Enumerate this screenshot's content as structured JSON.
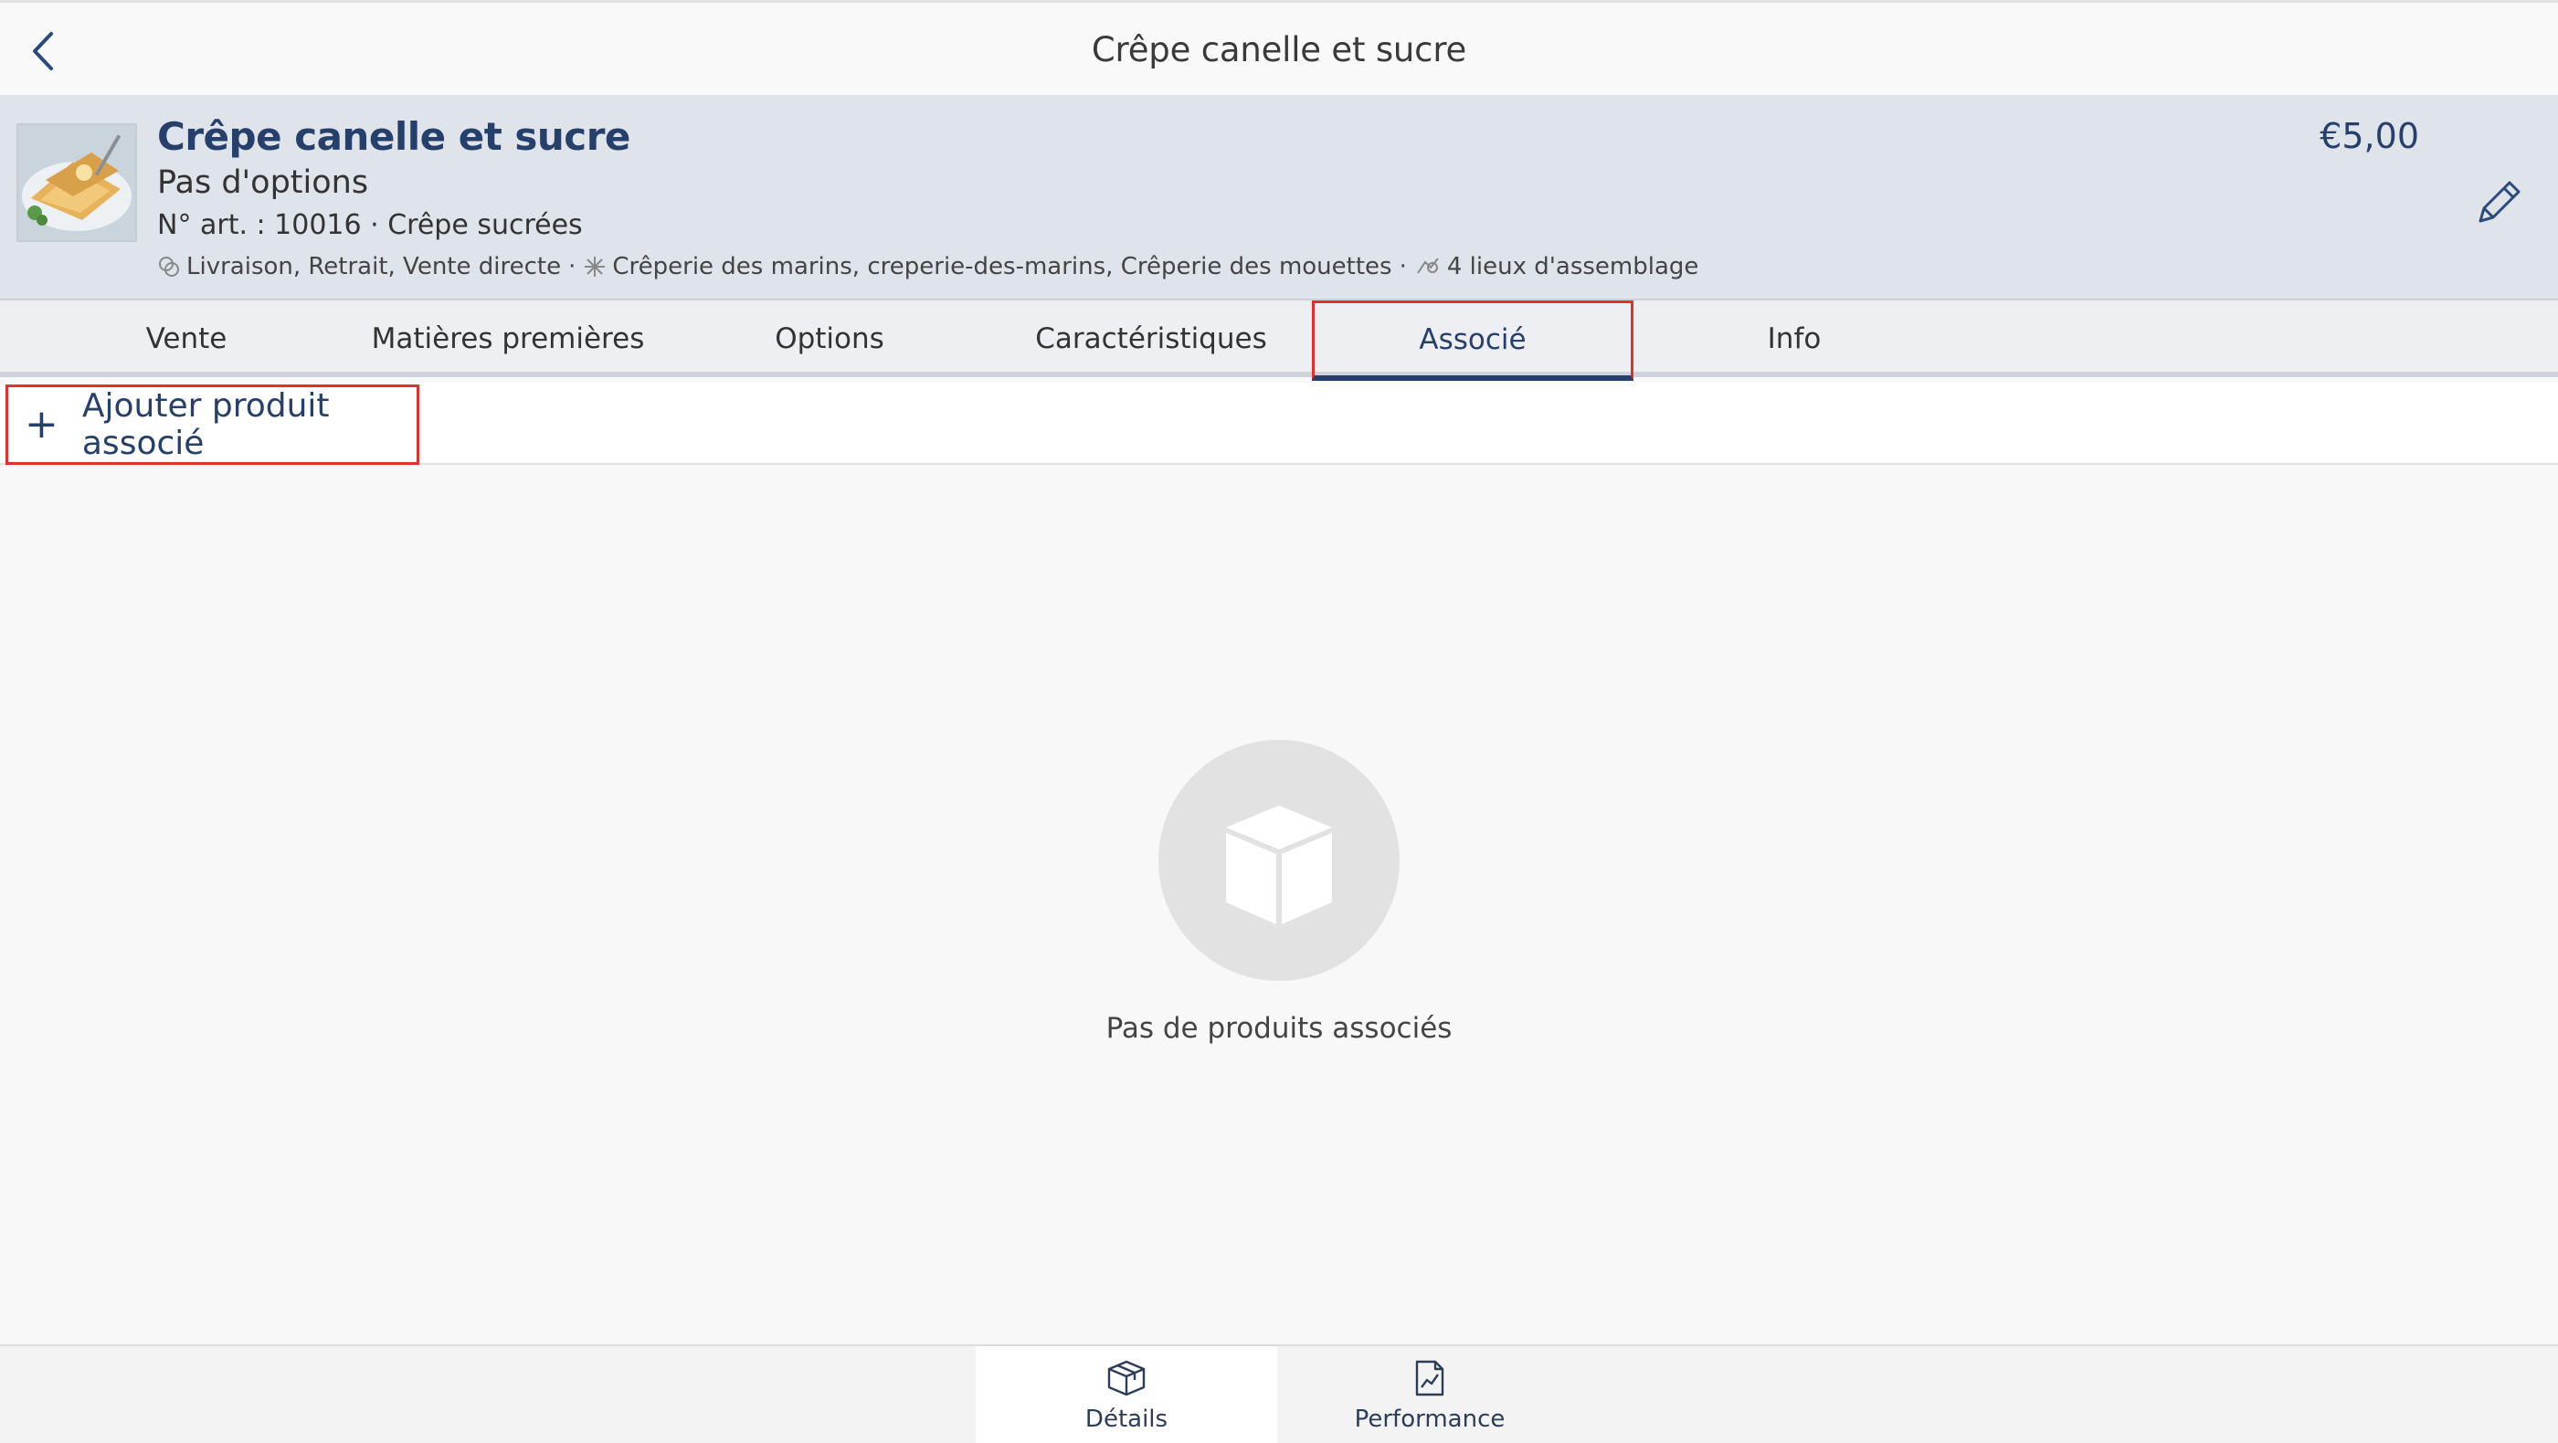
{
  "navbar": {
    "title": "Crêpe canelle et sucre",
    "back_icon": "chevron-left-icon"
  },
  "product": {
    "name": "Crêpe canelle et sucre",
    "options": "Pas d'options",
    "article": "N° art. : 10016 · Crêpe sucrées",
    "meta": {
      "channels": "Livraison, Retrait, Vente directe",
      "stores": "Crêperie des marins, creperie-des-marins, Crêperie des mouettes",
      "assembly": "4 lieux d'assemblage",
      "separator": "·"
    },
    "price": "€5,00",
    "edit_icon": "pencil-icon"
  },
  "tabs": [
    {
      "label": "Vente",
      "active": false
    },
    {
      "label": "Matières premières",
      "active": false
    },
    {
      "label": "Options",
      "active": false
    },
    {
      "label": "Caractéristiques",
      "active": false
    },
    {
      "label": "Associé",
      "active": true
    },
    {
      "label": "Info",
      "active": false
    }
  ],
  "add_action": {
    "icon": "+",
    "label": "Ajouter produit associé"
  },
  "empty_state": {
    "icon": "box-icon",
    "text": "Pas de produits associés"
  },
  "bottom_tabs": [
    {
      "label": "Détails",
      "icon": "box-icon",
      "active": true
    },
    {
      "label": "Performance",
      "icon": "chart-document-icon",
      "active": false
    }
  ],
  "colors": {
    "accent": "#26406b",
    "highlight": "#e0312f",
    "header_bg": "#dfe3ea"
  }
}
